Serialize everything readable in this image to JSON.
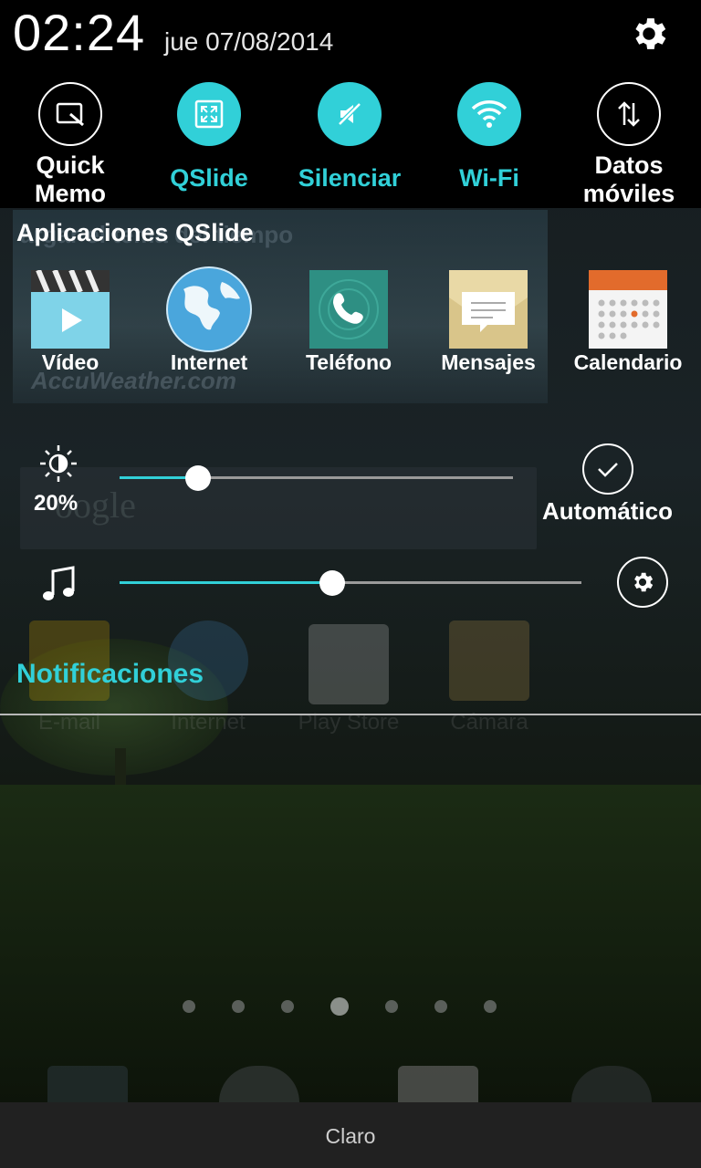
{
  "status": {
    "time": "02:24",
    "date": "jue 07/08/2014"
  },
  "toggles": [
    {
      "label_line1": "Quick",
      "label_line2": "Memo",
      "state": "off",
      "icon": "quick-memo-icon"
    },
    {
      "label": "QSlide",
      "state": "on",
      "icon": "qslide-icon"
    },
    {
      "label": "Silenciar",
      "state": "on",
      "icon": "mute-icon"
    },
    {
      "label": "Wi-Fi",
      "state": "on",
      "icon": "wifi-icon"
    },
    {
      "label_line1": "Datos",
      "label_line2": "móviles",
      "state": "off",
      "icon": "mobile-data-icon"
    }
  ],
  "qslide": {
    "title": "Aplicaciones QSlide",
    "apps": [
      {
        "label": "Vídeo",
        "icon": "video-icon"
      },
      {
        "label": "Internet",
        "icon": "globe-icon"
      },
      {
        "label": "Teléfono",
        "icon": "phone-icon"
      },
      {
        "label": "Mensajes",
        "icon": "messages-icon"
      },
      {
        "label": "Calendario",
        "icon": "calendar-icon"
      }
    ]
  },
  "brightness": {
    "percent_label": "20%",
    "level": 0.2,
    "auto_label": "Automático"
  },
  "volume": {
    "level": 0.46
  },
  "notifications": {
    "title": "Notificaciones"
  },
  "background": {
    "weather_text": "argar el tema del tiempo",
    "accuweather": "AccuWeather.com",
    "search_text": "oogle",
    "dock_labels": [
      "E-mail",
      "Internet",
      "Play Store",
      "Cámara"
    ]
  },
  "carrier": "Claro",
  "colors": {
    "accent": "#31d0d8",
    "panel": "#000000",
    "carrier_bar": "#212121"
  }
}
